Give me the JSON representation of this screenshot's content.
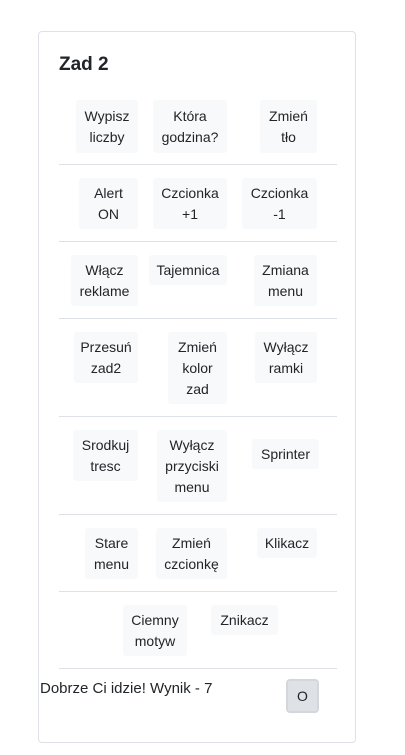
{
  "card": {
    "title": "Zad 2",
    "rows": [
      {
        "buttons": [
          {
            "label": "Wypisz\nliczby"
          },
          {
            "label": "Która\ngodzina?"
          },
          {
            "label": "Zmień\ntło"
          }
        ]
      },
      {
        "buttons": [
          {
            "label": "Alert\nON"
          },
          {
            "label": "Czcionka\n+1"
          },
          {
            "label": "Czcionka\n-1"
          }
        ]
      },
      {
        "buttons": [
          {
            "label": "Włącz\nreklame"
          },
          {
            "label": "Tajemnica"
          },
          {
            "label": "Zmiana\nmenu"
          }
        ]
      },
      {
        "buttons": [
          {
            "label": "Przesuń\nzad2"
          },
          {
            "label": "Zmień\nkolor\nzad"
          },
          {
            "label": "Wyłącz\nramki"
          }
        ]
      },
      {
        "buttons": [
          {
            "label": "Srodkuj\ntresc"
          },
          {
            "label": "Wyłącz\nprzyciski\nmenu"
          },
          {
            "label": "Sprinter"
          }
        ]
      },
      {
        "buttons": [
          {
            "label": "Stare\nmenu"
          },
          {
            "label": "Zmień\nczcionkę"
          },
          {
            "label": "Klikacz"
          }
        ]
      },
      {
        "buttons": [
          {
            "label": "Ciemny\nmotyw"
          },
          {
            "label": "Znikacz"
          }
        ]
      }
    ],
    "status_text": "Dobrze Ci idzie! Wynik - 7",
    "o_button_label": "O"
  }
}
